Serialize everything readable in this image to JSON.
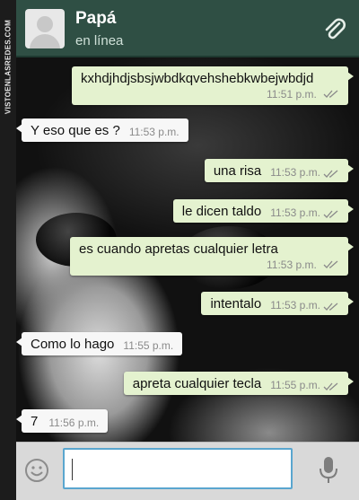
{
  "header": {
    "contact_name": "Papá",
    "status": "en línea"
  },
  "watermark": {
    "text": "VISTOENLASREDES.COM"
  },
  "messages": [
    {
      "dir": "out",
      "text": "kxhdjhdjsbsjwbdkqvehshebkwbejwbdjd",
      "time": "11:51 p.m."
    },
    {
      "dir": "in",
      "text": "Y eso que es ?",
      "time": "11:53 p.m."
    },
    {
      "dir": "out",
      "text": "una risa",
      "time": "11:53 p.m."
    },
    {
      "dir": "out",
      "text": "le dicen taldo",
      "time": "11:53 p.m."
    },
    {
      "dir": "out",
      "text": "es cuando apretas cualquier letra",
      "time": "11:53 p.m."
    },
    {
      "dir": "out",
      "text": "intentalo",
      "time": "11:53 p.m."
    },
    {
      "dir": "in",
      "text": "Como lo hago",
      "time": "11:55 p.m."
    },
    {
      "dir": "out",
      "text": "apreta cualquier tecla",
      "time": "11:55 p.m."
    },
    {
      "dir": "in",
      "text": "7",
      "time": "11:56 p.m."
    }
  ],
  "composer": {
    "value": "",
    "placeholder": ""
  },
  "icons": {
    "attach": "paperclip-icon",
    "emoji": "smiley-icon",
    "mic": "microphone-icon",
    "read": "double-check-icon"
  },
  "colors": {
    "header_bg": "#2f4f44",
    "outgoing_bubble": "#e4f2cf",
    "incoming_bubble": "#f7f7f7",
    "input_border": "#5aa6cf"
  }
}
